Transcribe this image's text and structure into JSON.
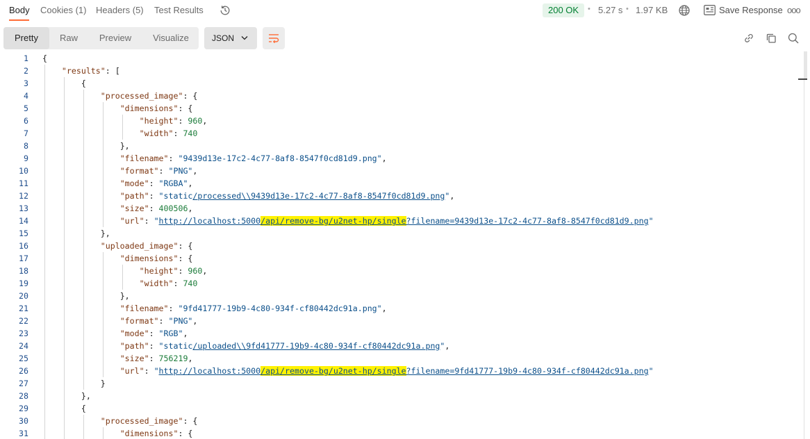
{
  "tabs": [
    {
      "label": "Body",
      "active": true
    },
    {
      "label": "Cookies (1)",
      "active": false
    },
    {
      "label": "Headers (5)",
      "active": false
    },
    {
      "label": "Test Results",
      "active": false
    }
  ],
  "status": {
    "code": "200 OK",
    "time": "5.27 s",
    "size": "1.97 KB"
  },
  "save_response_label": "Save Response",
  "view_tabs": [
    "Pretty",
    "Raw",
    "Preview",
    "Visualize"
  ],
  "active_view": "Pretty",
  "format": "JSON",
  "colors": {
    "accent": "#ff6c37",
    "status_ok": "#007f31",
    "highlight": "#fff200"
  },
  "code_lines": [
    {
      "n": "1",
      "indent": 0,
      "parts": [
        {
          "t": "p",
          "v": "{"
        }
      ]
    },
    {
      "n": "2",
      "indent": 1,
      "parts": [
        {
          "t": "k",
          "v": "\"results\""
        },
        {
          "t": "p",
          "v": ": ["
        }
      ]
    },
    {
      "n": "3",
      "indent": 2,
      "parts": [
        {
          "t": "p",
          "v": "{"
        }
      ]
    },
    {
      "n": "4",
      "indent": 3,
      "parts": [
        {
          "t": "k",
          "v": "\"processed_image\""
        },
        {
          "t": "p",
          "v": ": {"
        }
      ]
    },
    {
      "n": "5",
      "indent": 4,
      "parts": [
        {
          "t": "k",
          "v": "\"dimensions\""
        },
        {
          "t": "p",
          "v": ": {"
        }
      ]
    },
    {
      "n": "6",
      "indent": 5,
      "parts": [
        {
          "t": "k",
          "v": "\"height\""
        },
        {
          "t": "p",
          "v": ": "
        },
        {
          "t": "n",
          "v": "960"
        },
        {
          "t": "p",
          "v": ","
        }
      ]
    },
    {
      "n": "7",
      "indent": 5,
      "parts": [
        {
          "t": "k",
          "v": "\"width\""
        },
        {
          "t": "p",
          "v": ": "
        },
        {
          "t": "n",
          "v": "740"
        }
      ]
    },
    {
      "n": "8",
      "indent": 4,
      "parts": [
        {
          "t": "p",
          "v": "},"
        }
      ]
    },
    {
      "n": "9",
      "indent": 4,
      "parts": [
        {
          "t": "k",
          "v": "\"filename\""
        },
        {
          "t": "p",
          "v": ": "
        },
        {
          "t": "s",
          "v": "\"9439d13e-17c2-4c77-8af8-8547f0cd81d9.png\""
        },
        {
          "t": "p",
          "v": ","
        }
      ]
    },
    {
      "n": "10",
      "indent": 4,
      "parts": [
        {
          "t": "k",
          "v": "\"format\""
        },
        {
          "t": "p",
          "v": ": "
        },
        {
          "t": "s",
          "v": "\"PNG\""
        },
        {
          "t": "p",
          "v": ","
        }
      ]
    },
    {
      "n": "11",
      "indent": 4,
      "parts": [
        {
          "t": "k",
          "v": "\"mode\""
        },
        {
          "t": "p",
          "v": ": "
        },
        {
          "t": "s",
          "v": "\"RGBA\""
        },
        {
          "t": "p",
          "v": ","
        }
      ]
    },
    {
      "n": "12",
      "indent": 4,
      "parts": [
        {
          "t": "k",
          "v": "\"path\""
        },
        {
          "t": "p",
          "v": ": "
        },
        {
          "t": "s",
          "v": "\"static"
        },
        {
          "t": "l",
          "v": "/processed\\\\9439d13e-17c2-4c77-8af8-8547f0cd81d9.png"
        },
        {
          "t": "s",
          "v": "\""
        },
        {
          "t": "p",
          "v": ","
        }
      ]
    },
    {
      "n": "13",
      "indent": 4,
      "parts": [
        {
          "t": "k",
          "v": "\"size\""
        },
        {
          "t": "p",
          "v": ": "
        },
        {
          "t": "n",
          "v": "400506"
        },
        {
          "t": "p",
          "v": ","
        }
      ]
    },
    {
      "n": "14",
      "indent": 4,
      "parts": [
        {
          "t": "k",
          "v": "\"url\""
        },
        {
          "t": "p",
          "v": ": "
        },
        {
          "t": "s",
          "v": "\""
        },
        {
          "t": "l",
          "v": "http://localhost:5000"
        },
        {
          "t": "lh",
          "v": "/api/remove-bg/u2net-hp/single"
        },
        {
          "t": "l",
          "v": "?filename=9439d13e-17c2-4c77-8af8-8547f0cd81d9.png"
        },
        {
          "t": "s",
          "v": "\""
        }
      ]
    },
    {
      "n": "15",
      "indent": 3,
      "parts": [
        {
          "t": "p",
          "v": "},"
        }
      ]
    },
    {
      "n": "16",
      "indent": 3,
      "parts": [
        {
          "t": "k",
          "v": "\"uploaded_image\""
        },
        {
          "t": "p",
          "v": ": {"
        }
      ]
    },
    {
      "n": "17",
      "indent": 4,
      "parts": [
        {
          "t": "k",
          "v": "\"dimensions\""
        },
        {
          "t": "p",
          "v": ": {"
        }
      ]
    },
    {
      "n": "18",
      "indent": 5,
      "parts": [
        {
          "t": "k",
          "v": "\"height\""
        },
        {
          "t": "p",
          "v": ": "
        },
        {
          "t": "n",
          "v": "960"
        },
        {
          "t": "p",
          "v": ","
        }
      ]
    },
    {
      "n": "19",
      "indent": 5,
      "parts": [
        {
          "t": "k",
          "v": "\"width\""
        },
        {
          "t": "p",
          "v": ": "
        },
        {
          "t": "n",
          "v": "740"
        }
      ]
    },
    {
      "n": "20",
      "indent": 4,
      "parts": [
        {
          "t": "p",
          "v": "},"
        }
      ]
    },
    {
      "n": "21",
      "indent": 4,
      "parts": [
        {
          "t": "k",
          "v": "\"filename\""
        },
        {
          "t": "p",
          "v": ": "
        },
        {
          "t": "s",
          "v": "\"9fd41777-19b9-4c80-934f-cf80442dc91a.png\""
        },
        {
          "t": "p",
          "v": ","
        }
      ]
    },
    {
      "n": "22",
      "indent": 4,
      "parts": [
        {
          "t": "k",
          "v": "\"format\""
        },
        {
          "t": "p",
          "v": ": "
        },
        {
          "t": "s",
          "v": "\"PNG\""
        },
        {
          "t": "p",
          "v": ","
        }
      ]
    },
    {
      "n": "23",
      "indent": 4,
      "parts": [
        {
          "t": "k",
          "v": "\"mode\""
        },
        {
          "t": "p",
          "v": ": "
        },
        {
          "t": "s",
          "v": "\"RGB\""
        },
        {
          "t": "p",
          "v": ","
        }
      ]
    },
    {
      "n": "24",
      "indent": 4,
      "parts": [
        {
          "t": "k",
          "v": "\"path\""
        },
        {
          "t": "p",
          "v": ": "
        },
        {
          "t": "s",
          "v": "\"static"
        },
        {
          "t": "l",
          "v": "/uploaded\\\\9fd41777-19b9-4c80-934f-cf80442dc91a.png"
        },
        {
          "t": "s",
          "v": "\""
        },
        {
          "t": "p",
          "v": ","
        }
      ]
    },
    {
      "n": "25",
      "indent": 4,
      "parts": [
        {
          "t": "k",
          "v": "\"size\""
        },
        {
          "t": "p",
          "v": ": "
        },
        {
          "t": "n",
          "v": "756219"
        },
        {
          "t": "p",
          "v": ","
        }
      ]
    },
    {
      "n": "26",
      "indent": 4,
      "parts": [
        {
          "t": "k",
          "v": "\"url\""
        },
        {
          "t": "p",
          "v": ": "
        },
        {
          "t": "s",
          "v": "\""
        },
        {
          "t": "l",
          "v": "http://localhost:5000"
        },
        {
          "t": "lh",
          "v": "/api/remove-bg/u2net-hp/single"
        },
        {
          "t": "l",
          "v": "?filename=9fd41777-19b9-4c80-934f-cf80442dc91a.png"
        },
        {
          "t": "s",
          "v": "\""
        }
      ]
    },
    {
      "n": "27",
      "indent": 3,
      "parts": [
        {
          "t": "p",
          "v": "}"
        }
      ]
    },
    {
      "n": "28",
      "indent": 2,
      "parts": [
        {
          "t": "p",
          "v": "},"
        }
      ]
    },
    {
      "n": "29",
      "indent": 2,
      "parts": [
        {
          "t": "p",
          "v": "{"
        }
      ]
    },
    {
      "n": "30",
      "indent": 3,
      "parts": [
        {
          "t": "k",
          "v": "\"processed_image\""
        },
        {
          "t": "p",
          "v": ": {"
        }
      ]
    },
    {
      "n": "31",
      "indent": 4,
      "parts": [
        {
          "t": "k",
          "v": "\"dimensions\""
        },
        {
          "t": "p",
          "v": ": {"
        }
      ]
    }
  ]
}
